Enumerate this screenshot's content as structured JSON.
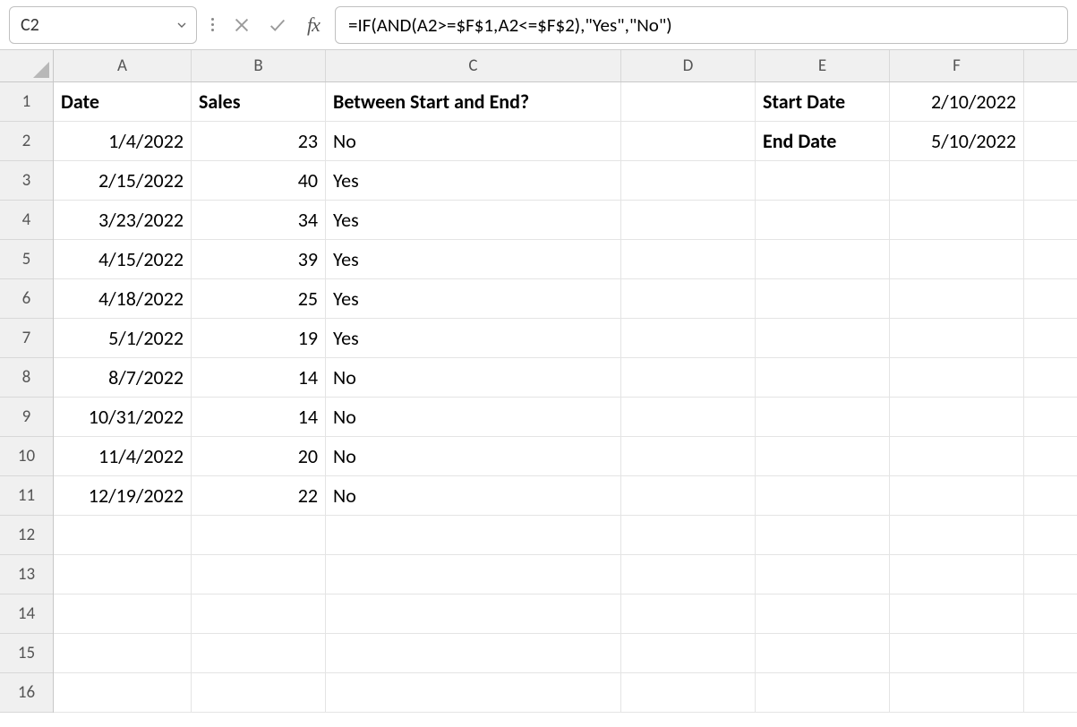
{
  "namebox": "C2",
  "formula": "=IF(AND(A2>=$F$1,A2<=$F$2),\"Yes\",\"No\")",
  "columns": [
    "A",
    "B",
    "C",
    "D",
    "E",
    "F"
  ],
  "rows": [
    "1",
    "2",
    "3",
    "4",
    "5",
    "6",
    "7",
    "8",
    "9",
    "10",
    "11",
    "12",
    "13",
    "14",
    "15",
    "16"
  ],
  "headers": {
    "A1": "Date",
    "B1": "Sales",
    "C1": "Between Start and End?",
    "E1": "Start Date",
    "E2": "End Date",
    "F1": "2/10/2022",
    "F2": "5/10/2022"
  },
  "data": [
    {
      "date": "1/4/2022",
      "sales": "23",
      "between": "No"
    },
    {
      "date": "2/15/2022",
      "sales": "40",
      "between": "Yes"
    },
    {
      "date": "3/23/2022",
      "sales": "34",
      "between": "Yes"
    },
    {
      "date": "4/15/2022",
      "sales": "39",
      "between": "Yes"
    },
    {
      "date": "4/18/2022",
      "sales": "25",
      "between": "Yes"
    },
    {
      "date": "5/1/2022",
      "sales": "19",
      "between": "Yes"
    },
    {
      "date": "8/7/2022",
      "sales": "14",
      "between": "No"
    },
    {
      "date": "10/31/2022",
      "sales": "14",
      "between": "No"
    },
    {
      "date": "11/4/2022",
      "sales": "20",
      "between": "No"
    },
    {
      "date": "12/19/2022",
      "sales": "22",
      "between": "No"
    }
  ]
}
